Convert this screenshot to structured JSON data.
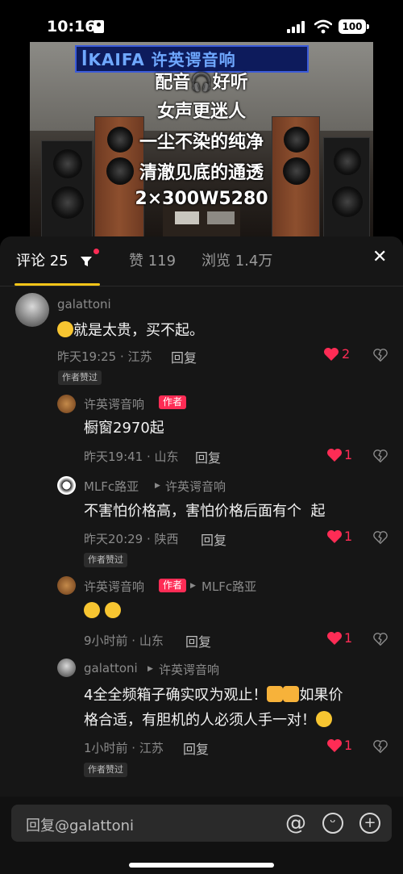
{
  "status_bar": {
    "time": "10:16",
    "battery": "100"
  },
  "video": {
    "banner_text": "ꟾKAIFA 许英谔音响",
    "lines": [
      "配音🎧好听",
      "女声更迷人",
      "一尘不染的纯净",
      "清澈见底的通透",
      "2×300W5280"
    ]
  },
  "tabs": {
    "comments_label": "评论",
    "comments_count": "25",
    "likes_label": "赞",
    "likes_count": "119",
    "views_label": "浏览",
    "views_count": "1.4万"
  },
  "comments": [
    {
      "user": "galattoni",
      "text": "就是太贵，买不起。",
      "meta": "昨天19:25 · 江苏",
      "reply": "回复",
      "likes": "2",
      "tag": "作者赞过"
    },
    {
      "user": "许英谔音响",
      "badge": "作者",
      "text": "橱窗2970起",
      "meta": "昨天19:41 · 山东",
      "reply": "回复",
      "likes": "1"
    },
    {
      "user": "MLFc路亚",
      "reply_to": "许英谔音响",
      "text": "不害怕价格高，害怕价格后面有个  起",
      "meta": "昨天20:29 · 陕西",
      "reply": "回复",
      "likes": "1",
      "tag": "作者赞过"
    },
    {
      "user": "许英谔音响",
      "badge": "作者",
      "reply_to": "MLFc路亚",
      "meta": "9小时前 · 山东",
      "reply": "回复",
      "likes": "1"
    },
    {
      "user": "galattoni",
      "reply_to": "许英谔音响",
      "text_line1a": "4全全频箱子确实叹为观止！",
      "text_line1b": "如果价",
      "text_line2": "格合适，有胆机的人必须人手一对！",
      "meta": "1小时前 · 江苏",
      "reply": "回复",
      "likes": "1",
      "tag": "作者赞过"
    }
  ],
  "input": {
    "placeholder": "回复@galattoni"
  },
  "colors": {
    "accent": "#fe2c55",
    "tab_underline": "#f5c518",
    "panel": "#161616"
  }
}
